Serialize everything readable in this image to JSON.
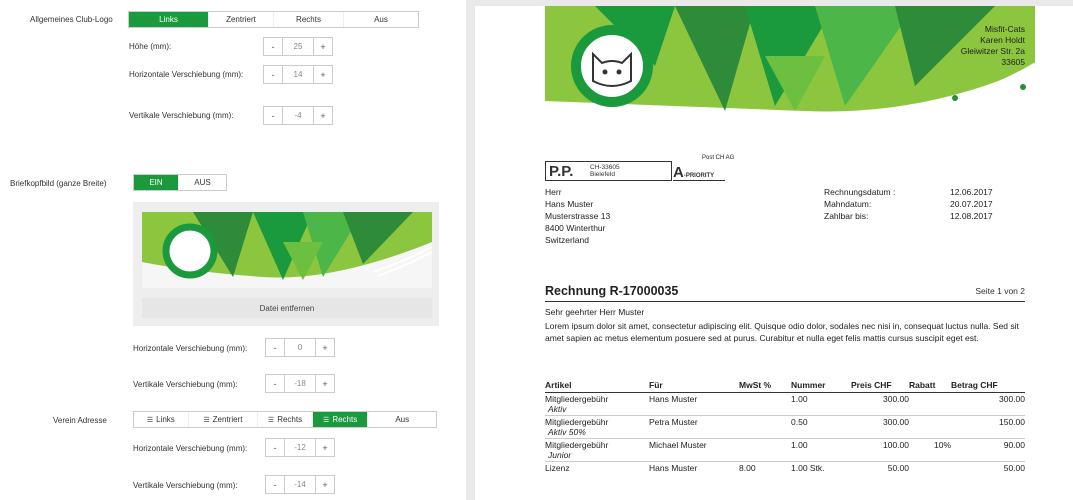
{
  "settings": {
    "club_logo": {
      "label": "Allgemeines Club-Logo",
      "options": [
        "Links",
        "Zentriert",
        "Rechts",
        "Aus"
      ],
      "active": 0,
      "height_label": "Höhe (mm):",
      "height_value": "25",
      "hshift_label": "Horizontale Verschiebung (mm):",
      "hshift_value": "14",
      "vshift_label": "Vertikale Verschiebung (mm):",
      "vshift_value": "-4"
    },
    "header_image": {
      "label": "Briefkopfbild (ganze Breite)",
      "options": [
        "EIN",
        "AUS"
      ],
      "active": 0,
      "remove_label": "Datei entfernen",
      "hshift_label": "Horizontale Verschiebung (mm):",
      "hshift_value": "0",
      "vshift_label": "Vertikale Verschiebung (mm):",
      "vshift_value": "-18"
    },
    "club_address": {
      "label": "Verein Adresse",
      "options": [
        "Links",
        "Zentriert",
        "Rechts",
        "Rechts",
        "Aus"
      ],
      "active": 3,
      "hshift_label": "Horizontale Verschiebung (mm):",
      "hshift_value": "-12",
      "vshift_label": "Vertikale Verschiebung (mm):",
      "vshift_value": "-14"
    },
    "minus": "-",
    "plus": "+"
  },
  "invoice": {
    "club_address": [
      "Misfit-Cats",
      "Karen Holdt",
      "Gleiwitzer Str. 2a",
      "33605"
    ],
    "postage": {
      "post": "Post CH AG",
      "pp": "P.P.",
      "zip": "CH-33605",
      "city": "Bielefeld",
      "a": "A",
      "priority": "-PRIORITY"
    },
    "recipient": [
      "Herr",
      "Hans Muster",
      "Musterstrasse 13",
      "8400 Winterthur",
      "Switzerland"
    ],
    "meta": [
      {
        "label": "Rechnungsdatum :",
        "value": "12.06.2017"
      },
      {
        "label": "Mahndatum:",
        "value": "20.07.2017"
      },
      {
        "label": "Zahlbar bis:",
        "value": "12.08.2017"
      }
    ],
    "title": "Rechnung R-17000035",
    "page": "Seite 1 von 2",
    "salutation": "Sehr geehrter Herr Muster",
    "body": "Lorem ipsum dolor sit amet, consectetur adipiscing elit. Quisque odio dolor, sodales nec nisi in, consequat luctus nulla. Sed sit amet sapien ac metus elementum posuere sed at purus. Curabitur et nulla eget felis mattis cursus suscipit eget est.",
    "columns": [
      "Artikel",
      "Für",
      "MwSt %",
      "Nummer",
      "Preis CHF",
      "Rabatt",
      "Betrag CHF"
    ],
    "rows": [
      {
        "article": "Mitgliedergebühr",
        "sub": "Aktiv",
        "for": "Hans Muster",
        "vat": "",
        "number": "1.00",
        "price": "300.00",
        "discount": "",
        "amount": "300.00"
      },
      {
        "article": "Mitgliedergebühr",
        "sub": "Aktiv 50%",
        "for": "Petra Muster",
        "vat": "",
        "number": "0.50",
        "price": "300.00",
        "discount": "",
        "amount": "150.00"
      },
      {
        "article": "Mitgliedergebühr",
        "sub": "Junior",
        "for": "Michael Muster",
        "vat": "",
        "number": "1.00",
        "price": "100.00",
        "discount": "10%",
        "amount": "90.00"
      },
      {
        "article": "Lizenz",
        "sub": "",
        "for": "Hans Muster",
        "vat": "8.00",
        "number": "1.00 Stk.",
        "price": "50.00",
        "discount": "",
        "amount": "50.00"
      }
    ]
  },
  "colors": {
    "accent": "#1a9a3d",
    "green_light": "#8cc63f",
    "green_mid": "#4cb648",
    "green_dark": "#2e8b3a"
  }
}
